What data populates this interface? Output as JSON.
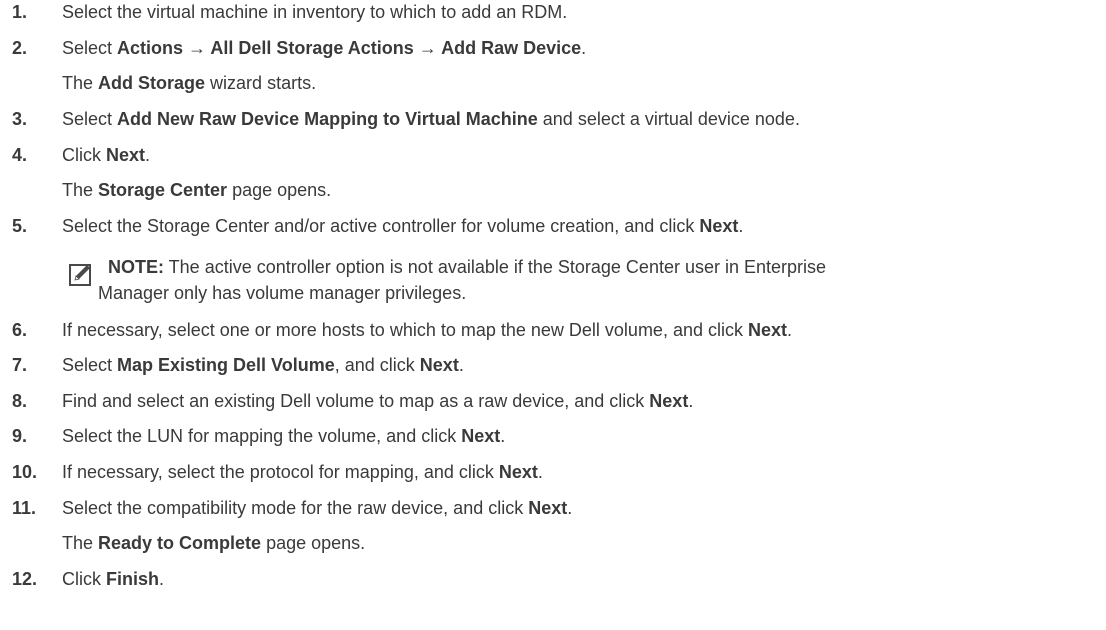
{
  "steps": [
    {
      "num": "1.",
      "a": "Select the virtual machine in inventory to which to add an RDM.",
      "b1": "",
      "c": "",
      "b2": "",
      "d": ""
    },
    {
      "num": "2.",
      "a": "Select ",
      "b1": "Actions → All Dell Storage Actions → Add Raw Device",
      "c": ".",
      "b2": "",
      "d": ""
    },
    {
      "num": "3.",
      "a": "Select ",
      "b1": "Add New Raw Device Mapping to Virtual Machine",
      "c": " and select a virtual device node.",
      "b2": "",
      "d": ""
    },
    {
      "num": "4.",
      "a": "Click ",
      "b1": "Next",
      "c": ".",
      "b2": "",
      "d": ""
    },
    {
      "num": "5.",
      "a": "Select the Storage Center and/or active controller for volume creation, and click ",
      "b1": "Next",
      "c": ".",
      "b2": "",
      "d": ""
    },
    {
      "num": "6.",
      "a": "If necessary, select one or more hosts to which to map the new Dell volume, and click ",
      "b1": "Next",
      "c": ".",
      "b2": "",
      "d": ""
    },
    {
      "num": "7.",
      "a": "Select ",
      "b1": "Map Existing Dell Volume",
      "c": ", and click ",
      "b2": "Next",
      "d": "."
    },
    {
      "num": "8.",
      "a": "Find and select an existing Dell volume to map as a raw device, and click ",
      "b1": "Next",
      "c": ".",
      "b2": "",
      "d": ""
    },
    {
      "num": "9.",
      "a": "Select the LUN for mapping the volume, and click ",
      "b1": "Next",
      "c": ".",
      "b2": "",
      "d": ""
    },
    {
      "num": "10.",
      "a": "If necessary, select the protocol for mapping, and click ",
      "b1": "Next",
      "c": ".",
      "b2": "",
      "d": ""
    },
    {
      "num": "11.",
      "a": "Select the compatibility mode for the raw device, and click ",
      "b1": "Next",
      "c": ".",
      "b2": "",
      "d": ""
    },
    {
      "num": "12.",
      "a": "Click ",
      "b1": "Finish",
      "c": ".",
      "b2": "",
      "d": ""
    }
  ],
  "results": {
    "after_2": {
      "a": "The ",
      "b": "Add Storage",
      "c": " wizard starts."
    },
    "after_4": {
      "a": "The ",
      "b": "Storage Center",
      "c": " page opens."
    },
    "after_11": {
      "a": "The ",
      "b": "Ready to Complete",
      "c": " page opens."
    }
  },
  "note": {
    "label": "NOTE:",
    "line1": " The active controller option is not available if the Storage Center user in Enterprise",
    "line2": "Manager only has volume manager privileges.",
    "icon": "pencil-note-icon"
  }
}
